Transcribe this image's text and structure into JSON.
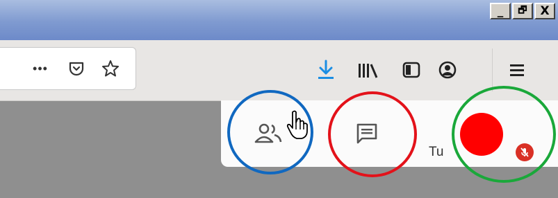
{
  "window": {
    "buttons": [
      {
        "name": "minimize",
        "glyph": "_"
      },
      {
        "name": "restore",
        "glyph": "🗗"
      },
      {
        "name": "close",
        "glyph": "X"
      }
    ]
  },
  "toolbar": {
    "page_actions_glyph": "•••",
    "icons": [
      "page-actions-icon",
      "pocket-icon",
      "bookmark-star-icon",
      "download-icon",
      "library-icon",
      "sidebar-icon",
      "account-icon",
      "menu-icon"
    ]
  },
  "meeting_bar": {
    "participant_text": "Tu",
    "icons": [
      "participants-icon",
      "chat-icon",
      "self-video-tile",
      "mic-muted-icon",
      "hand-cursor-icon"
    ]
  },
  "colors": {
    "titlebar": "#7f9ad0",
    "download_accent": "#1a8de3",
    "record_red": "#ff0000",
    "circle_blue": "#1068c0",
    "circle_red": "#e3121a",
    "circle_green": "#1aa83a",
    "mute_badge": "#d93025"
  }
}
